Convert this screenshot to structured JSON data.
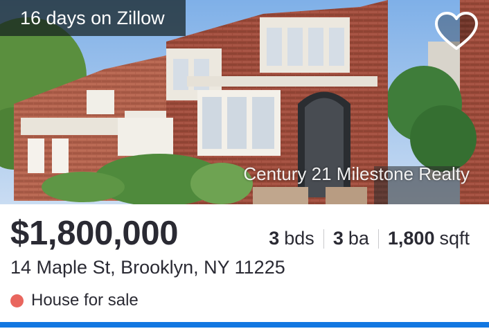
{
  "listing": {
    "days_badge": "16 days on Zillow",
    "photo_credit": "Century 21 Milestone Realty",
    "favorite_icon": "heart-outline-icon",
    "price": "$1,800,000",
    "beds_value": "3",
    "beds_unit": "bds",
    "baths_value": "3",
    "baths_unit": "ba",
    "sqft_value": "1,800",
    "sqft_unit": "sqft",
    "address": "14 Maple St, Brooklyn, NY 11225",
    "status": "House for sale"
  },
  "colors": {
    "status_dot": "#e9665e",
    "accent_bar": "#1277e1",
    "text": "#2a2a33"
  }
}
